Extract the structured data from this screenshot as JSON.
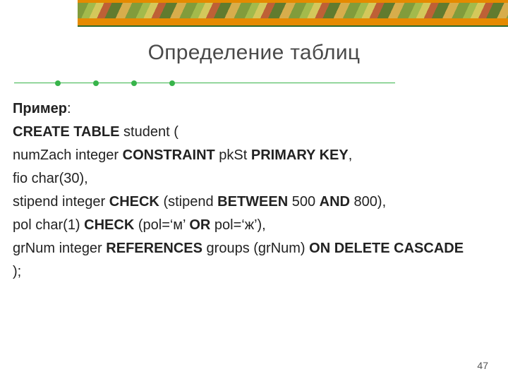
{
  "slide": {
    "title": "Определение таблиц",
    "example_label": "Пример",
    "line2_a": "CREATE TABLE",
    "line2_b": " student (",
    "line3_a": "numZach integer ",
    "line3_b": "CONSTRAINT",
    "line3_c": " pkSt ",
    "line3_d": "PRIMARY KEY",
    "line3_e": ",",
    "line4": "fio char(30),",
    "line5_a": "stipend integer ",
    "line5_b": "CHECK",
    "line5_c": " (stipend ",
    "line5_d": "BETWEEN",
    "line5_e": " 500 ",
    "line5_f": "AND",
    "line5_g": " 800),",
    "line6_a": "pol char(1) ",
    "line6_b": "CHECK",
    "line6_c": " (pol=‘м’ ",
    "line6_d": "OR",
    "line6_e": " pol=‘ж’),",
    "line7_a": "grNum integer ",
    "line7_b": "REFERENCES",
    "line7_c": " groups (grNum) ",
    "line7_d": "ON DELETE CASCADE",
    "line8": ");",
    "page_number": "47"
  }
}
